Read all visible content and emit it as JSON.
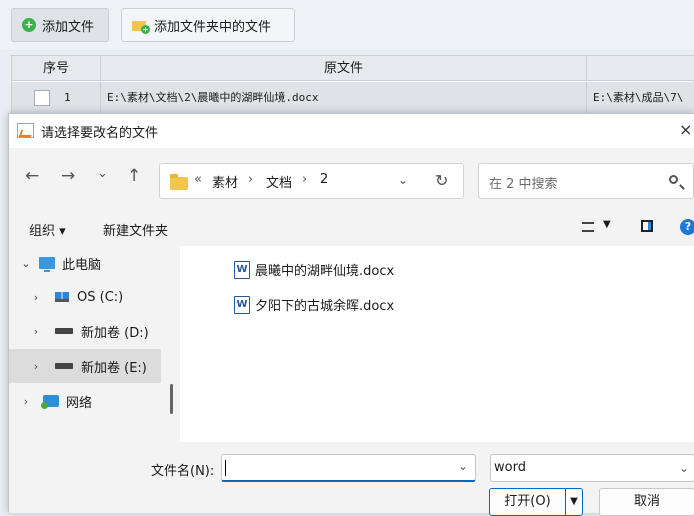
{
  "toolbar": {
    "add_file": "添加文件",
    "add_folder_files": "添加文件夹中的文件"
  },
  "grid": {
    "columns": [
      "序号",
      "原文件"
    ],
    "rows": [
      {
        "index": "1",
        "original": "E:\\素材\\文档\\2\\晨曦中的湖畔仙境.docx",
        "target": "E:\\素材\\成品\\7\\"
      }
    ]
  },
  "dialog": {
    "title": "请选择要改名的文件",
    "close": "×",
    "nav": {
      "back": "←",
      "forward": "→",
      "recent": "⌄",
      "up": "↑",
      "refresh": "↻"
    },
    "address": {
      "prefix": "«",
      "parts": [
        "素材",
        "文档",
        "2"
      ],
      "sep": "›"
    },
    "search_placeholder": "在 2 中搜索",
    "commands": {
      "organize": "组织 ▾",
      "new_folder": "新建文件夹"
    },
    "tree": [
      {
        "label": "此电脑",
        "icon": "pc-icon",
        "expanded": true
      },
      {
        "label": "OS (C:)",
        "icon": "os-drive-icon"
      },
      {
        "label": "新加卷 (D:)",
        "icon": "drive-icon"
      },
      {
        "label": "新加卷 (E:)",
        "icon": "drive-icon",
        "selected": true
      },
      {
        "label": "网络",
        "icon": "network-icon"
      }
    ],
    "files": [
      "晨曦中的湖畔仙境.docx",
      "夕阳下的古城余晖.docx"
    ],
    "filename_label": "文件名(N):",
    "filename_value": "",
    "filetype": "word",
    "open_label": "打开(O)",
    "cancel_label": "取消"
  },
  "colors": {
    "accent": "#0067c0",
    "selected": "#dcdcdc",
    "folder": "#f4c54e",
    "word": "#2b579a"
  }
}
